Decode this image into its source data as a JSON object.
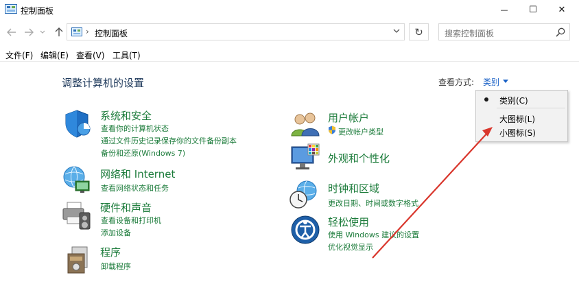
{
  "window": {
    "title": "控制面板",
    "minimize_glyph": "—",
    "maximize_glyph": "☐",
    "close_glyph": "✕"
  },
  "address": {
    "separator": "›",
    "path": "控制面板",
    "refresh_glyph": "↻"
  },
  "search": {
    "placeholder": "搜索控制面板"
  },
  "menubar": {
    "items": [
      {
        "label": "文件(F)"
      },
      {
        "label": "编辑(E)"
      },
      {
        "label": "查看(V)"
      },
      {
        "label": "工具(T)"
      }
    ]
  },
  "content": {
    "heading": "调整计算机的设置",
    "view_by_label": "查看方式:",
    "view_by_value": "类别"
  },
  "view_dropdown": {
    "items": [
      {
        "label": "类别(C)",
        "selected": true
      },
      {
        "label": "大图标(L)",
        "selected": false
      },
      {
        "label": "小图标(S)",
        "selected": false
      }
    ]
  },
  "categories": {
    "system_security": {
      "title": "系统和安全",
      "links": [
        "查看你的计算机状态",
        "通过文件历史记录保存你的文件备份副本",
        "备份和还原(Windows 7)"
      ]
    },
    "network": {
      "title": "网络和 Internet",
      "links": [
        "查看网络状态和任务"
      ]
    },
    "hardware": {
      "title": "硬件和声音",
      "links": [
        "查看设备和打印机",
        "添加设备"
      ]
    },
    "programs": {
      "title": "程序",
      "links": [
        "卸载程序"
      ]
    },
    "user_accounts": {
      "title": "用户帐户",
      "links": [
        "更改帐户类型"
      ]
    },
    "appearance": {
      "title": "外观和个性化",
      "links": []
    },
    "clock_region": {
      "title": "时钟和区域",
      "links": [
        "更改日期、时间或数字格式"
      ]
    },
    "ease_of_access": {
      "title": "轻松使用",
      "links": [
        "使用 Windows 建议的设置",
        "优化视觉显示"
      ]
    }
  },
  "colors": {
    "link_green": "#1b7b3a",
    "accent_blue": "#1a62c7",
    "annotation_arrow": "#d9362c"
  },
  "icons": {
    "titlebar": "control-panel-icon",
    "back": "back-arrow-icon",
    "forward": "forward-arrow-icon",
    "recent": "recent-locations-icon",
    "up": "up-arrow-icon",
    "search": "search-icon"
  }
}
